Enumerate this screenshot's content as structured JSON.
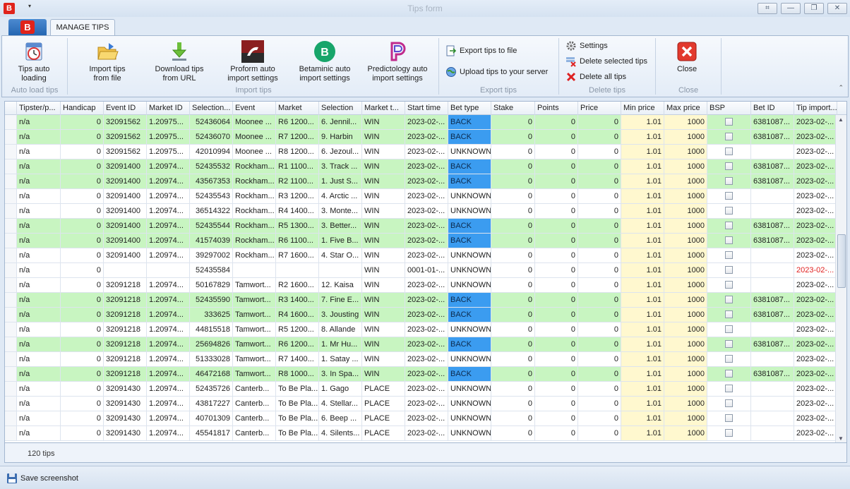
{
  "window": {
    "title": "Tips form",
    "app_letter": "B",
    "tab_label": "MANAGE TIPS",
    "qa_dropdown": "▾",
    "controls": [
      "⌗",
      "—",
      "❐",
      "✕"
    ]
  },
  "ribbon": {
    "tips_auto_loading": "Tips auto loading",
    "group_auto_load": "Auto load tips",
    "import_tips_from_file": "Import tips from file",
    "download_tips_from_url": "Download tips from URL",
    "proform_settings": "Proform auto import settings",
    "betaminic_settings": "Betaminic auto import settings",
    "predictology_settings": "Predictology auto import settings",
    "group_import": "Import tips",
    "export_to_file": "Export tips to file",
    "upload_to_server": "Upload tips to your server",
    "group_export": "Export tips",
    "settings": "Settings",
    "delete_selected": "Delete selected tips",
    "delete_all": "Delete all tips",
    "group_delete": "Delete tips",
    "close": "Close",
    "group_close": "Close"
  },
  "columns": [
    "Tipster/p...",
    "Handicap",
    "Event ID",
    "Market ID",
    "Selection...",
    "Event",
    "Market",
    "Selection",
    "Market t...",
    "Start time",
    "Bet type",
    "Stake",
    "Points",
    "Price",
    "Min price",
    "Max price",
    "BSP",
    "Bet ID",
    "Tip import..."
  ],
  "rows": [
    {
      "g": 1,
      "c": [
        "n/a",
        "0",
        "32091562",
        "1.20975...",
        "52436064",
        "Moonee ...",
        "R6 1200...",
        "6. Jennil...",
        "WIN",
        "2023-02-...",
        "BACK",
        "0",
        "0",
        "0",
        "1.01",
        "1000",
        "",
        "6381087...",
        "2023-02-..."
      ]
    },
    {
      "g": 1,
      "c": [
        "n/a",
        "0",
        "32091562",
        "1.20975...",
        "52436070",
        "Moonee ...",
        "R7 1200...",
        "9. Harbin",
        "WIN",
        "2023-02-...",
        "BACK",
        "0",
        "0",
        "0",
        "1.01",
        "1000",
        "",
        "6381087...",
        "2023-02-..."
      ]
    },
    {
      "g": 0,
      "c": [
        "n/a",
        "0",
        "32091562",
        "1.20975...",
        "42010994",
        "Moonee ...",
        "R8 1200...",
        "6. Jezoul...",
        "WIN",
        "2023-02-...",
        "UNKNOWN",
        "0",
        "0",
        "0",
        "1.01",
        "1000",
        "",
        "",
        "2023-02-..."
      ]
    },
    {
      "g": 1,
      "c": [
        "n/a",
        "0",
        "32091400",
        "1.20974...",
        "52435532",
        "Rockham...",
        "R1 1100...",
        "3. Track ...",
        "WIN",
        "2023-02-...",
        "BACK",
        "0",
        "0",
        "0",
        "1.01",
        "1000",
        "",
        "6381087...",
        "2023-02-..."
      ]
    },
    {
      "g": 1,
      "c": [
        "n/a",
        "0",
        "32091400",
        "1.20974...",
        "43567353",
        "Rockham...",
        "R2 1100...",
        "1. Just S...",
        "WIN",
        "2023-02-...",
        "BACK",
        "0",
        "0",
        "0",
        "1.01",
        "1000",
        "",
        "6381087...",
        "2023-02-..."
      ]
    },
    {
      "g": 0,
      "c": [
        "n/a",
        "0",
        "32091400",
        "1.20974...",
        "52435543",
        "Rockham...",
        "R3 1200...",
        "4. Arctic ...",
        "WIN",
        "2023-02-...",
        "UNKNOWN",
        "0",
        "0",
        "0",
        "1.01",
        "1000",
        "",
        "",
        "2023-02-..."
      ]
    },
    {
      "g": 0,
      "c": [
        "n/a",
        "0",
        "32091400",
        "1.20974...",
        "36514322",
        "Rockham...",
        "R4 1400...",
        "3. Monte...",
        "WIN",
        "2023-02-...",
        "UNKNOWN",
        "0",
        "0",
        "0",
        "1.01",
        "1000",
        "",
        "",
        "2023-02-..."
      ]
    },
    {
      "g": 1,
      "c": [
        "n/a",
        "0",
        "32091400",
        "1.20974...",
        "52435544",
        "Rockham...",
        "R5 1300...",
        "3. Better...",
        "WIN",
        "2023-02-...",
        "BACK",
        "0",
        "0",
        "0",
        "1.01",
        "1000",
        "",
        "6381087...",
        "2023-02-..."
      ]
    },
    {
      "g": 1,
      "c": [
        "n/a",
        "0",
        "32091400",
        "1.20974...",
        "41574039",
        "Rockham...",
        "R6 1100...",
        "1. Five B...",
        "WIN",
        "2023-02-...",
        "BACK",
        "0",
        "0",
        "0",
        "1.01",
        "1000",
        "",
        "6381087...",
        "2023-02-..."
      ]
    },
    {
      "g": 0,
      "c": [
        "n/a",
        "0",
        "32091400",
        "1.20974...",
        "39297002",
        "Rockham...",
        "R7 1600...",
        "4. Star O...",
        "WIN",
        "2023-02-...",
        "UNKNOWN",
        "0",
        "0",
        "0",
        "1.01",
        "1000",
        "",
        "",
        "2023-02-..."
      ]
    },
    {
      "g": 0,
      "r": 1,
      "c": [
        "n/a",
        "0",
        "",
        "",
        "52435584",
        "",
        "",
        "",
        "WIN",
        "0001-01-...",
        "UNKNOWN",
        "0",
        "0",
        "0",
        "1.01",
        "1000",
        "",
        "",
        "2023-02-..."
      ]
    },
    {
      "g": 0,
      "c": [
        "n/a",
        "0",
        "32091218",
        "1.20974...",
        "50167829",
        "Tamwort...",
        "R2 1600...",
        "12. Kaisa",
        "WIN",
        "2023-02-...",
        "UNKNOWN",
        "0",
        "0",
        "0",
        "1.01",
        "1000",
        "",
        "",
        "2023-02-..."
      ]
    },
    {
      "g": 1,
      "c": [
        "n/a",
        "0",
        "32091218",
        "1.20974...",
        "52435590",
        "Tamwort...",
        "R3 1400...",
        "7. Fine E...",
        "WIN",
        "2023-02-...",
        "BACK",
        "0",
        "0",
        "0",
        "1.01",
        "1000",
        "",
        "6381087...",
        "2023-02-..."
      ]
    },
    {
      "g": 1,
      "c": [
        "n/a",
        "0",
        "32091218",
        "1.20974...",
        "333625",
        "Tamwort...",
        "R4 1600...",
        "3. Jousting",
        "WIN",
        "2023-02-...",
        "BACK",
        "0",
        "0",
        "0",
        "1.01",
        "1000",
        "",
        "6381087...",
        "2023-02-..."
      ]
    },
    {
      "g": 0,
      "c": [
        "n/a",
        "0",
        "32091218",
        "1.20974...",
        "44815518",
        "Tamwort...",
        "R5 1200...",
        "8. Allande",
        "WIN",
        "2023-02-...",
        "UNKNOWN",
        "0",
        "0",
        "0",
        "1.01",
        "1000",
        "",
        "",
        "2023-02-..."
      ]
    },
    {
      "g": 1,
      "c": [
        "n/a",
        "0",
        "32091218",
        "1.20974...",
        "25694826",
        "Tamwort...",
        "R6 1200...",
        "1. Mr Hu...",
        "WIN",
        "2023-02-...",
        "BACK",
        "0",
        "0",
        "0",
        "1.01",
        "1000",
        "",
        "6381087...",
        "2023-02-..."
      ]
    },
    {
      "g": 0,
      "c": [
        "n/a",
        "0",
        "32091218",
        "1.20974...",
        "51333028",
        "Tamwort...",
        "R7 1400...",
        "1. Satay ...",
        "WIN",
        "2023-02-...",
        "UNKNOWN",
        "0",
        "0",
        "0",
        "1.01",
        "1000",
        "",
        "",
        "2023-02-..."
      ]
    },
    {
      "g": 1,
      "c": [
        "n/a",
        "0",
        "32091218",
        "1.20974...",
        "46472168",
        "Tamwort...",
        "R8 1000...",
        "3. In Spa...",
        "WIN",
        "2023-02-...",
        "BACK",
        "0",
        "0",
        "0",
        "1.01",
        "1000",
        "",
        "6381087...",
        "2023-02-..."
      ]
    },
    {
      "g": 0,
      "c": [
        "n/a",
        "0",
        "32091430",
        "1.20974...",
        "52435726",
        "Canterb...",
        "To Be Pla...",
        "1. Gago",
        "PLACE",
        "2023-02-...",
        "UNKNOWN",
        "0",
        "0",
        "0",
        "1.01",
        "1000",
        "",
        "",
        "2023-02-..."
      ]
    },
    {
      "g": 0,
      "c": [
        "n/a",
        "0",
        "32091430",
        "1.20974...",
        "43817227",
        "Canterb...",
        "To Be Pla...",
        "4. Stellar...",
        "PLACE",
        "2023-02-...",
        "UNKNOWN",
        "0",
        "0",
        "0",
        "1.01",
        "1000",
        "",
        "",
        "2023-02-..."
      ]
    },
    {
      "g": 0,
      "c": [
        "n/a",
        "0",
        "32091430",
        "1.20974...",
        "40701309",
        "Canterb...",
        "To Be Pla...",
        "6. Beep ...",
        "PLACE",
        "2023-02-...",
        "UNKNOWN",
        "0",
        "0",
        "0",
        "1.01",
        "1000",
        "",
        "",
        "2023-02-..."
      ]
    },
    {
      "g": 0,
      "c": [
        "n/a",
        "0",
        "32091430",
        "1.20974...",
        "45541817",
        "Canterb...",
        "To Be Pla...",
        "4. Silents...",
        "PLACE",
        "2023-02-...",
        "UNKNOWN",
        "0",
        "0",
        "0",
        "1.01",
        "1000",
        "",
        "",
        "2023-02-..."
      ]
    }
  ],
  "footer": {
    "count": "120 tips",
    "save_screenshot": "Save screenshot"
  },
  "colors": {
    "green_row": "#c8f5c1",
    "back_cell": "#3b9cf0",
    "minmax_cell": "#fff8cf",
    "red_text": "#e02020"
  }
}
